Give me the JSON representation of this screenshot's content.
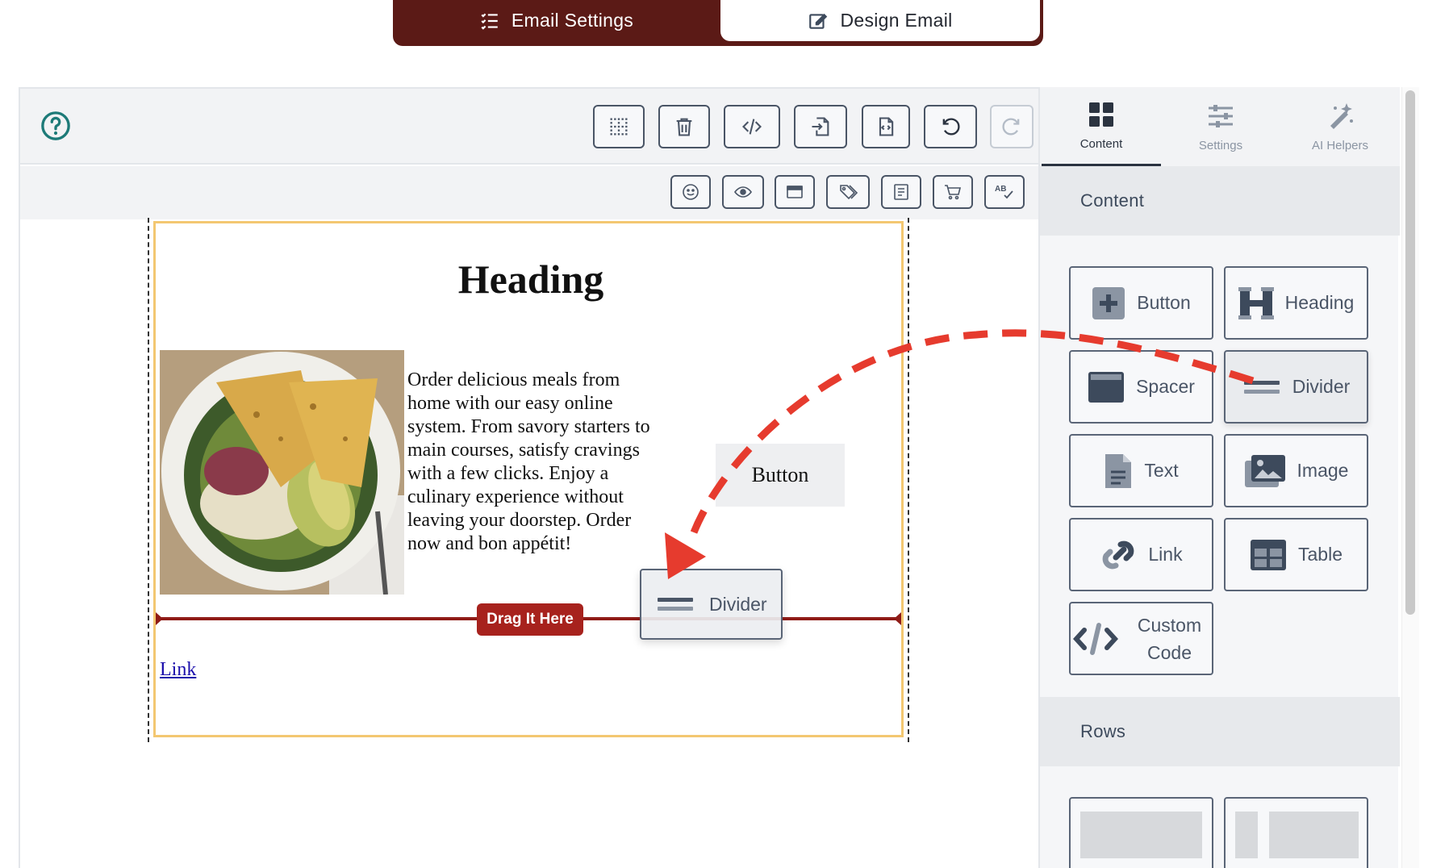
{
  "mode_switch": {
    "email_settings": "Email Settings",
    "design_email": "Design Email"
  },
  "email": {
    "heading": "Heading",
    "body": "Order delicious meals from home with our easy online system. From savory starters to main courses, satisfy cravings with a few clicks. Enjoy a culinary experience without leaving your doorstep. Order now and bon appétit!",
    "button": "Button",
    "drop_badge": "Drag It Here",
    "link": "Link",
    "dragged_block": "Divider"
  },
  "panel": {
    "tabs": [
      {
        "label": "Content",
        "icon": "grid-icon",
        "active": true
      },
      {
        "label": "Settings",
        "icon": "sliders-icon",
        "active": false
      },
      {
        "label": "AI Helpers",
        "icon": "magic-wand-icon",
        "active": false
      }
    ],
    "content_header": "Content",
    "blocks": [
      {
        "label": "Button",
        "icon": "plus-square-icon"
      },
      {
        "label": "Heading",
        "icon": "heading-h-icon"
      },
      {
        "label": "Spacer",
        "icon": "spacer-icon"
      },
      {
        "label": "Divider",
        "icon": "divider-icon"
      },
      {
        "label": "Text",
        "icon": "document-icon"
      },
      {
        "label": "Image",
        "icon": "image-icon"
      },
      {
        "label": "Link",
        "icon": "chain-link-icon"
      },
      {
        "label": "Table",
        "icon": "table-icon"
      },
      {
        "label": "Custom Code",
        "icon": "code-icon"
      }
    ],
    "rows_header": "Rows"
  },
  "colors": {
    "brand_dark_red": "#5b1a16",
    "drop_line_red": "#8f1b17",
    "arrow_red": "#e63b2e",
    "canvas_border_yellow": "#f3c771"
  }
}
